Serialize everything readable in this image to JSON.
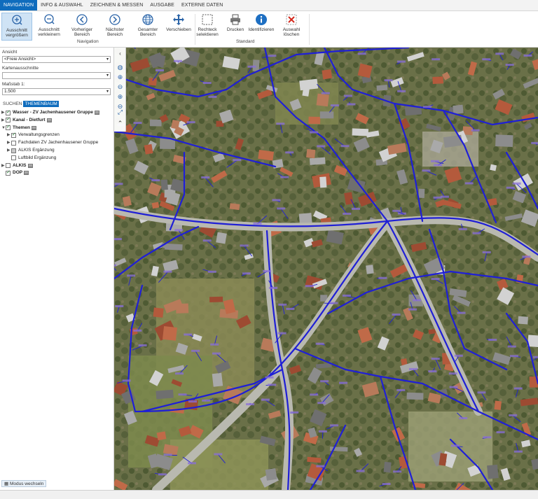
{
  "tabs": [
    "NAVIGATION",
    "INFO & AUSWAHL",
    "ZEICHNEN & MESSEN",
    "AUSGABE",
    "EXTERNE DATEN"
  ],
  "ribbon": {
    "zoom_in": "Ausschnitt vergrößern",
    "zoom_out": "Ausschnitt verkleinern",
    "prev": "Vorheriger Bereich",
    "next": "Nächster Bereich",
    "full": "Gesamter Bereich",
    "pan": "Verschieben",
    "rect": "Rechteck selektieren",
    "print": "Drucken",
    "identify": "Identifizieren",
    "clear": "Auswahl löschen",
    "group_navigation": "Navigation",
    "group_standard": "Standard"
  },
  "panel": {
    "ansicht_label": "Ansicht",
    "ansicht_value": "<Freie Ansicht>",
    "karten_label": "Kartenausschnitte",
    "karten_value": "",
    "massstab_label": "Maßstab 1:",
    "massstab_value": "1.500",
    "subtab_suchen": "SUCHEN",
    "subtab_themenbaum": "THEMENBAUM",
    "mode_button": "Modus wechseln"
  },
  "tree": [
    {
      "label": "Wasser - ZV Jachenhausener Gruppe",
      "checked": true,
      "bold": true,
      "level": 0,
      "expander": "▶",
      "legend": true
    },
    {
      "label": "Kanal - Dietfurt",
      "checked": true,
      "bold": true,
      "level": 0,
      "expander": "▶",
      "legend": true
    },
    {
      "label": "Themen",
      "checked": true,
      "bold": true,
      "level": 0,
      "expander": "▼",
      "legend": true
    },
    {
      "label": "Verwaltungsgrenzen",
      "checked": true,
      "bold": false,
      "level": 1,
      "expander": "▶",
      "legend": false
    },
    {
      "label": "Fachdaten ZV Jachenhausener Gruppe",
      "checked": false,
      "bold": false,
      "level": 1,
      "expander": "▶",
      "legend": false
    },
    {
      "label": "ALKIS Ergänzung",
      "checked": false,
      "bold": false,
      "level": 1,
      "expander": "▶",
      "legend": false,
      "partial": true
    },
    {
      "label": "Luftbild Ergänzung",
      "checked": false,
      "bold": false,
      "level": 1,
      "expander": "",
      "legend": false
    },
    {
      "label": "ALKIS",
      "checked": false,
      "bold": true,
      "level": 0,
      "expander": "▶",
      "legend": true
    },
    {
      "label": "DOP",
      "checked": true,
      "bold": true,
      "level": 0,
      "expander": "",
      "legend": true
    }
  ],
  "colors": {
    "accent": "#0f6cbd",
    "network": "#1f1fd6"
  },
  "map_tool_icons": [
    "globe-icon",
    "zoom-in-icon",
    "zoom-out-icon",
    "zoom-in-small-icon",
    "zoom-out-small-icon",
    "full-extent-icon",
    "collapse-icon"
  ]
}
